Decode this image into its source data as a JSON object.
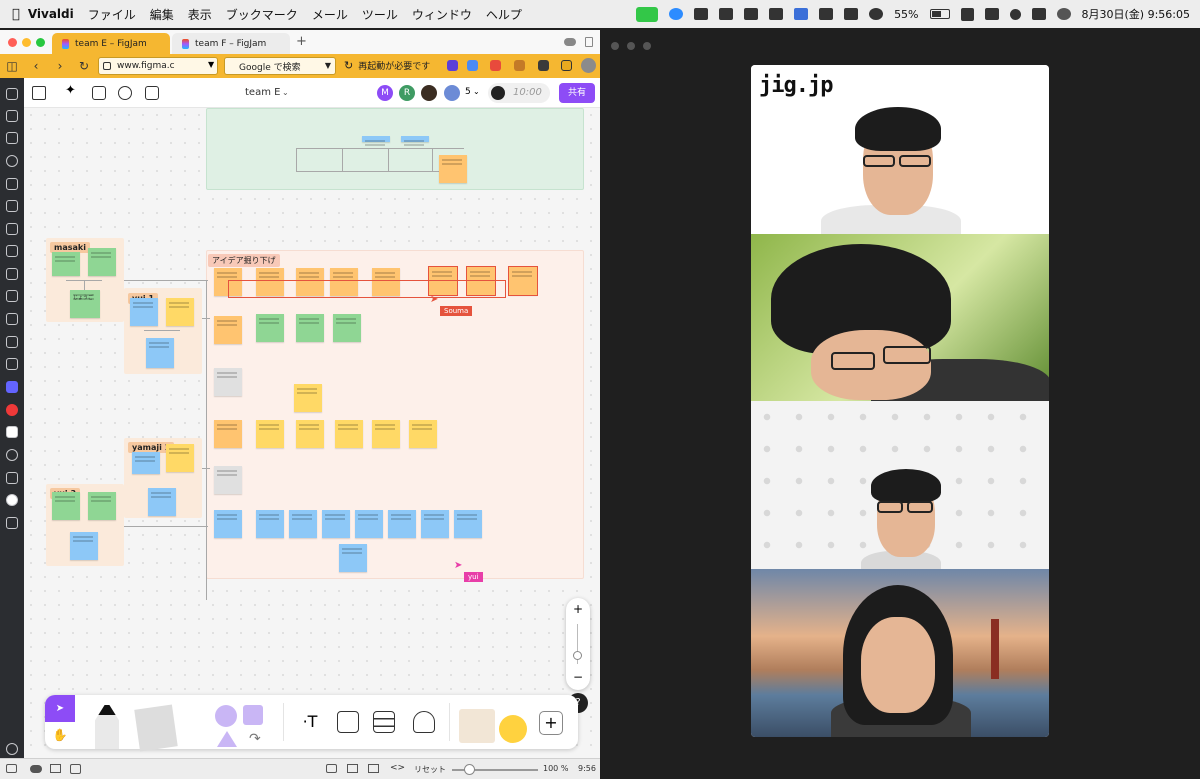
{
  "menubar": {
    "app": "Vivaldi",
    "items": [
      "ファイル",
      "編集",
      "表示",
      "ブックマーク",
      "メール",
      "ツール",
      "ウィンドウ",
      "ヘルプ"
    ],
    "battery": "55%",
    "datetime": "8月30日(金)  9:56:05"
  },
  "browser": {
    "tabs": [
      {
        "label": "team E – FigJam"
      },
      {
        "label": "team F – FigJam"
      }
    ],
    "url": "www.figma.c",
    "search_placeholder": "Google で検索",
    "restart_notice": "再起動が必要です"
  },
  "figjam": {
    "file_title": "team E",
    "avatars": [
      "M",
      "R"
    ],
    "participant_count": "5",
    "timer": "10:00",
    "share_label": "共有",
    "section_title": "アイデア掘り下げ",
    "group_labels": [
      "masaki",
      "yui 1",
      "yamaji 1",
      "yui 3"
    ],
    "sticky_visible_text": "じょうご",
    "cursors": [
      {
        "name": "Souma",
        "color": "#e5533d"
      },
      {
        "name": "yui",
        "color": "#e83ea8"
      }
    ]
  },
  "statusbar": {
    "reset_label": "リセット",
    "zoom": "100 %",
    "time": "9:56"
  },
  "video": {
    "brand_logo": "jig.jp"
  },
  "colors": {
    "vivaldi_accent": "#f5b731",
    "figma_purple": "#8d4cf6",
    "section_pink": "#fde9e1",
    "section_green": "#dff0e4"
  }
}
